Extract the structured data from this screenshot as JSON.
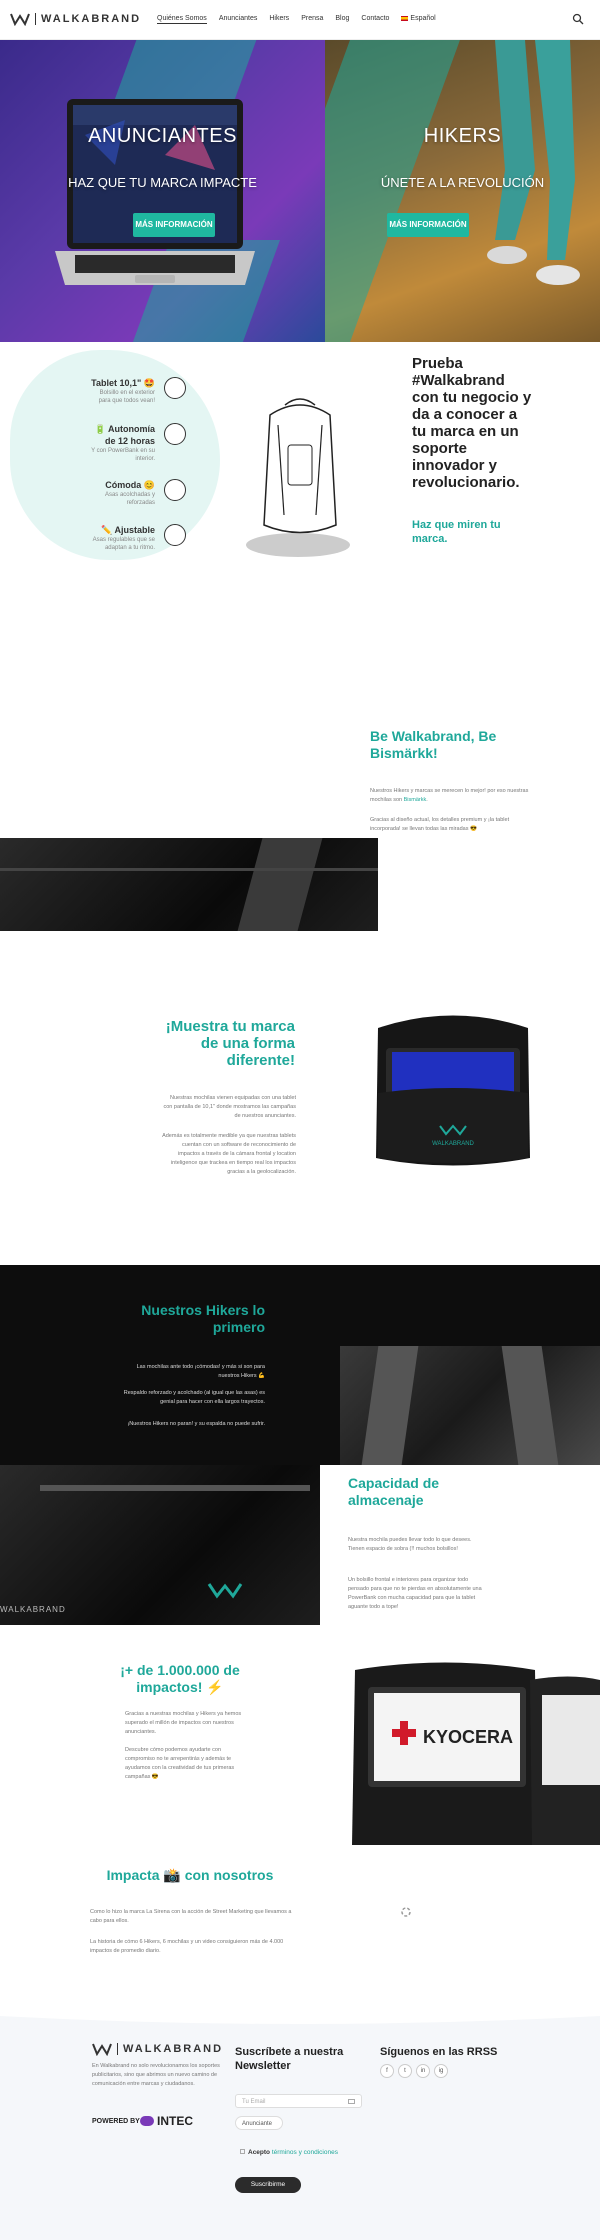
{
  "header": {
    "logo_text": "WALKABRAND",
    "nav": [
      "Quiénes Somos",
      "Anunciantes",
      "Hikers",
      "Prensa",
      "Blog",
      "Contacto",
      "Español"
    ]
  },
  "hero": {
    "left_title": "ANUNCIANTES",
    "left_sub": "HAZ QUE TU MARCA IMPACTE",
    "left_btn": "MÁS INFORMACIÓN",
    "right_title": "HIKERS",
    "right_sub": "ÚNETE A LA REVOLUCIÓN",
    "right_btn": "MÁS INFORMACIÓN"
  },
  "features": [
    {
      "title": "Tablet 10,1\" 🤩",
      "desc": [
        "Bolsillo en el exterior",
        "para que todos vean!"
      ]
    },
    {
      "title": "🔋 Autonomía",
      "title2": "de 12 horas",
      "desc": [
        "Y con PowerBank en su",
        "interior."
      ]
    },
    {
      "title": "Cómoda 😊",
      "desc": [
        "Asas acolchadas y",
        "reforzadas"
      ]
    },
    {
      "title": "✏️ Ajustable",
      "desc": [
        "Asas regulables que se",
        "adaptan a tu ritmo."
      ]
    }
  ],
  "promo": {
    "text": "Prueba #Walkabrand con tu negocio y da a conocer a tu marca en un soporte innovador y revolucionario.",
    "sub": "Haz que miren tu marca."
  },
  "bismarkk": {
    "title": "Be Walkabrand, Be Bismärkk!",
    "p1a": "Nuestros Hikers y marcas se merecen lo mejor! por eso nuestras mochilas son ",
    "p1link": "Bismärkk",
    "p1b": ".",
    "p2": "Gracias al diseño actual, los detalles premium y ¡la tablet incorporada! se llevan todas las miradas 😎"
  },
  "brandshow": {
    "title": "¡Muestra tu marca de una forma diferente!",
    "p1": "Nuestras mochilas vienen equipadas con una tablet con pantalla de 10,1\" donde mostramos las campañas de nuestros anunciantes.",
    "p2": "Además es totalmente medible ya que nuestras tablets cuentan con un software de reconocimiento de impactos a través de la cámara frontal y location inteligence que trackea en tiempo real los impactos gracias a la geolocalización.",
    "bag_brand": "WALKABRAND"
  },
  "hikers": {
    "title": "Nuestros Hikers lo primero",
    "p1": "Las mochilas ante todo ¡cómodas! y más si son para nuestros Hikers 💪",
    "p2": "Respaldo reforzado y acolchado (al igual que las asas) es genial para hacer con ella largos trayectos.",
    "p3": "¡Nuestros Hikers no paran! y su espalda no puede sufrir."
  },
  "capacity": {
    "title": "Capacidad de almacenaje",
    "p1": "Nuestra mochila puedes llevar todo lo que desees. Tienen espacio de sobra (!! muchos bolsillos!",
    "p2": "Un bolsillo frontal e interiores para organizar todo pensado para que no te pierdas en absolutamente una PowerBank con mucha capacidad para que la tablet aguante todo a tope!",
    "bag_brand": "WALKABRAND"
  },
  "impacts": {
    "title": "¡+ de 1.000.000 de impactos! ⚡",
    "p1": "Gracias a nuestras mochilas y Hikers ya hemos superado el millón de impactos con nuestros anunciantes.",
    "p2": "Descubre cómo podemos ayudarte con compromiso no te arrepentirás y además te ayudamos con la creatividad de tus primeras campañas 😎",
    "screen_brand": "KYOCERA"
  },
  "impacta": {
    "title": "Impacta 📸 con nosotros",
    "p1": "Como lo hizo la marca La Sirena con la acción de Street Marketing que llevamos a cabo para ellos.",
    "p2": "La historia de cómo 6 Hikers, 6 mochilas y un video consiguieron más de 4.000 impactos de promedio diario."
  },
  "footer": {
    "logo_text": "WALKABRAND",
    "about": "En Walkabrand no solo revolucionamos los soportes publicitarios, sino que abrimos un nuevo camino de comunicación entre marcas y ciudadanos.",
    "powered": "POWERED BY",
    "intec": "INTEC",
    "newsletter_title": "Suscríbete a nuestra Newsletter",
    "email_placeholder": "Tu Email",
    "select_value": "Anunciante",
    "accept_text": "Acepto",
    "terms_link": "términos y condiciones",
    "subscribe_btn": "Suscribirme",
    "social_title": "Síguenos en las RRSS",
    "social": [
      "f",
      "t",
      "in",
      "ig"
    ]
  },
  "colors": {
    "accent": "#1fa89a",
    "dark": "#0d0d0d"
  }
}
